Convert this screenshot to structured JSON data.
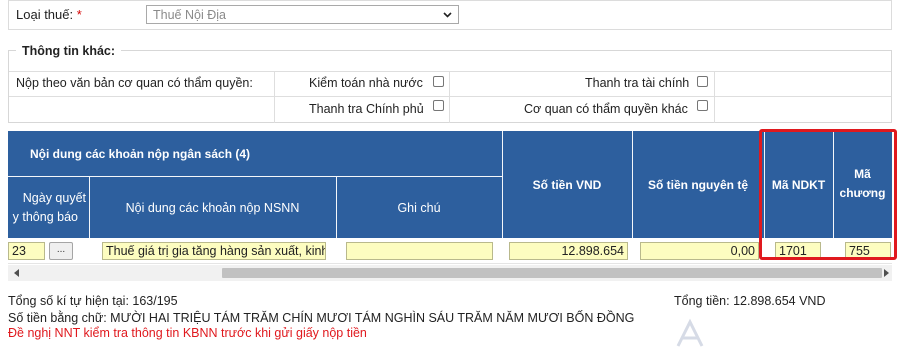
{
  "tax": {
    "label": "Loại thuế:",
    "required_mark": "*",
    "selected": "Thuế Nội Địa"
  },
  "other_info": {
    "legend": "Thông tin khác:",
    "row_label": "Nộp theo văn bản cơ quan có thẩm quyền:",
    "checks": [
      {
        "label": "Kiểm toán nhà nước",
        "checked": false
      },
      {
        "label": "Thanh tra tài chính",
        "checked": false
      },
      {
        "label": "Thanh tra Chính phủ",
        "checked": false
      },
      {
        "label": "Cơ quan có thẩm quyền khác",
        "checked": false
      }
    ]
  },
  "table": {
    "group_header": "Nội dung các khoản nộp ngân sách (4)",
    "headers": {
      "date_line1": "Ngày quyết",
      "date_line2": "y thông báo",
      "content": "Nội dung các khoản nộp NSNN",
      "note": "Ghi chú",
      "amount_vnd": "Số tiền VND",
      "amount_orig": "Số tiền nguyên tệ",
      "ndkt": "Mã NDKT",
      "chapter_line1": "Mã",
      "chapter_line2": "chương"
    },
    "row": {
      "date": "23",
      "dots": "...",
      "content": "Thuế giá trị gia tăng hàng sản xuất, kinh",
      "note": "",
      "amount_vnd": "12.898.654",
      "amount_orig": "0,00",
      "ndkt": "1701",
      "chapter": "755"
    }
  },
  "footer": {
    "char_count": "Tổng số kí tự hiện tại: 163/195",
    "total": "Tổng tiền: 12.898.654 VND",
    "in_words": "Số tiền bằng chữ: MƯỜI HAI TRIỆU TÁM TRĂM CHÍN MƯƠI TÁM NGHÌN SÁU TRĂM NĂM MƯƠI BỐN ĐỒNG",
    "warning": "Đề nghị NNT kiểm tra thông tin KBNN trước khi gửi giấy nộp tiền"
  },
  "colors": {
    "header_blue": "#2d5f9e",
    "input_yellow": "#fdfdc0",
    "highlight_red": "#e0191e"
  }
}
